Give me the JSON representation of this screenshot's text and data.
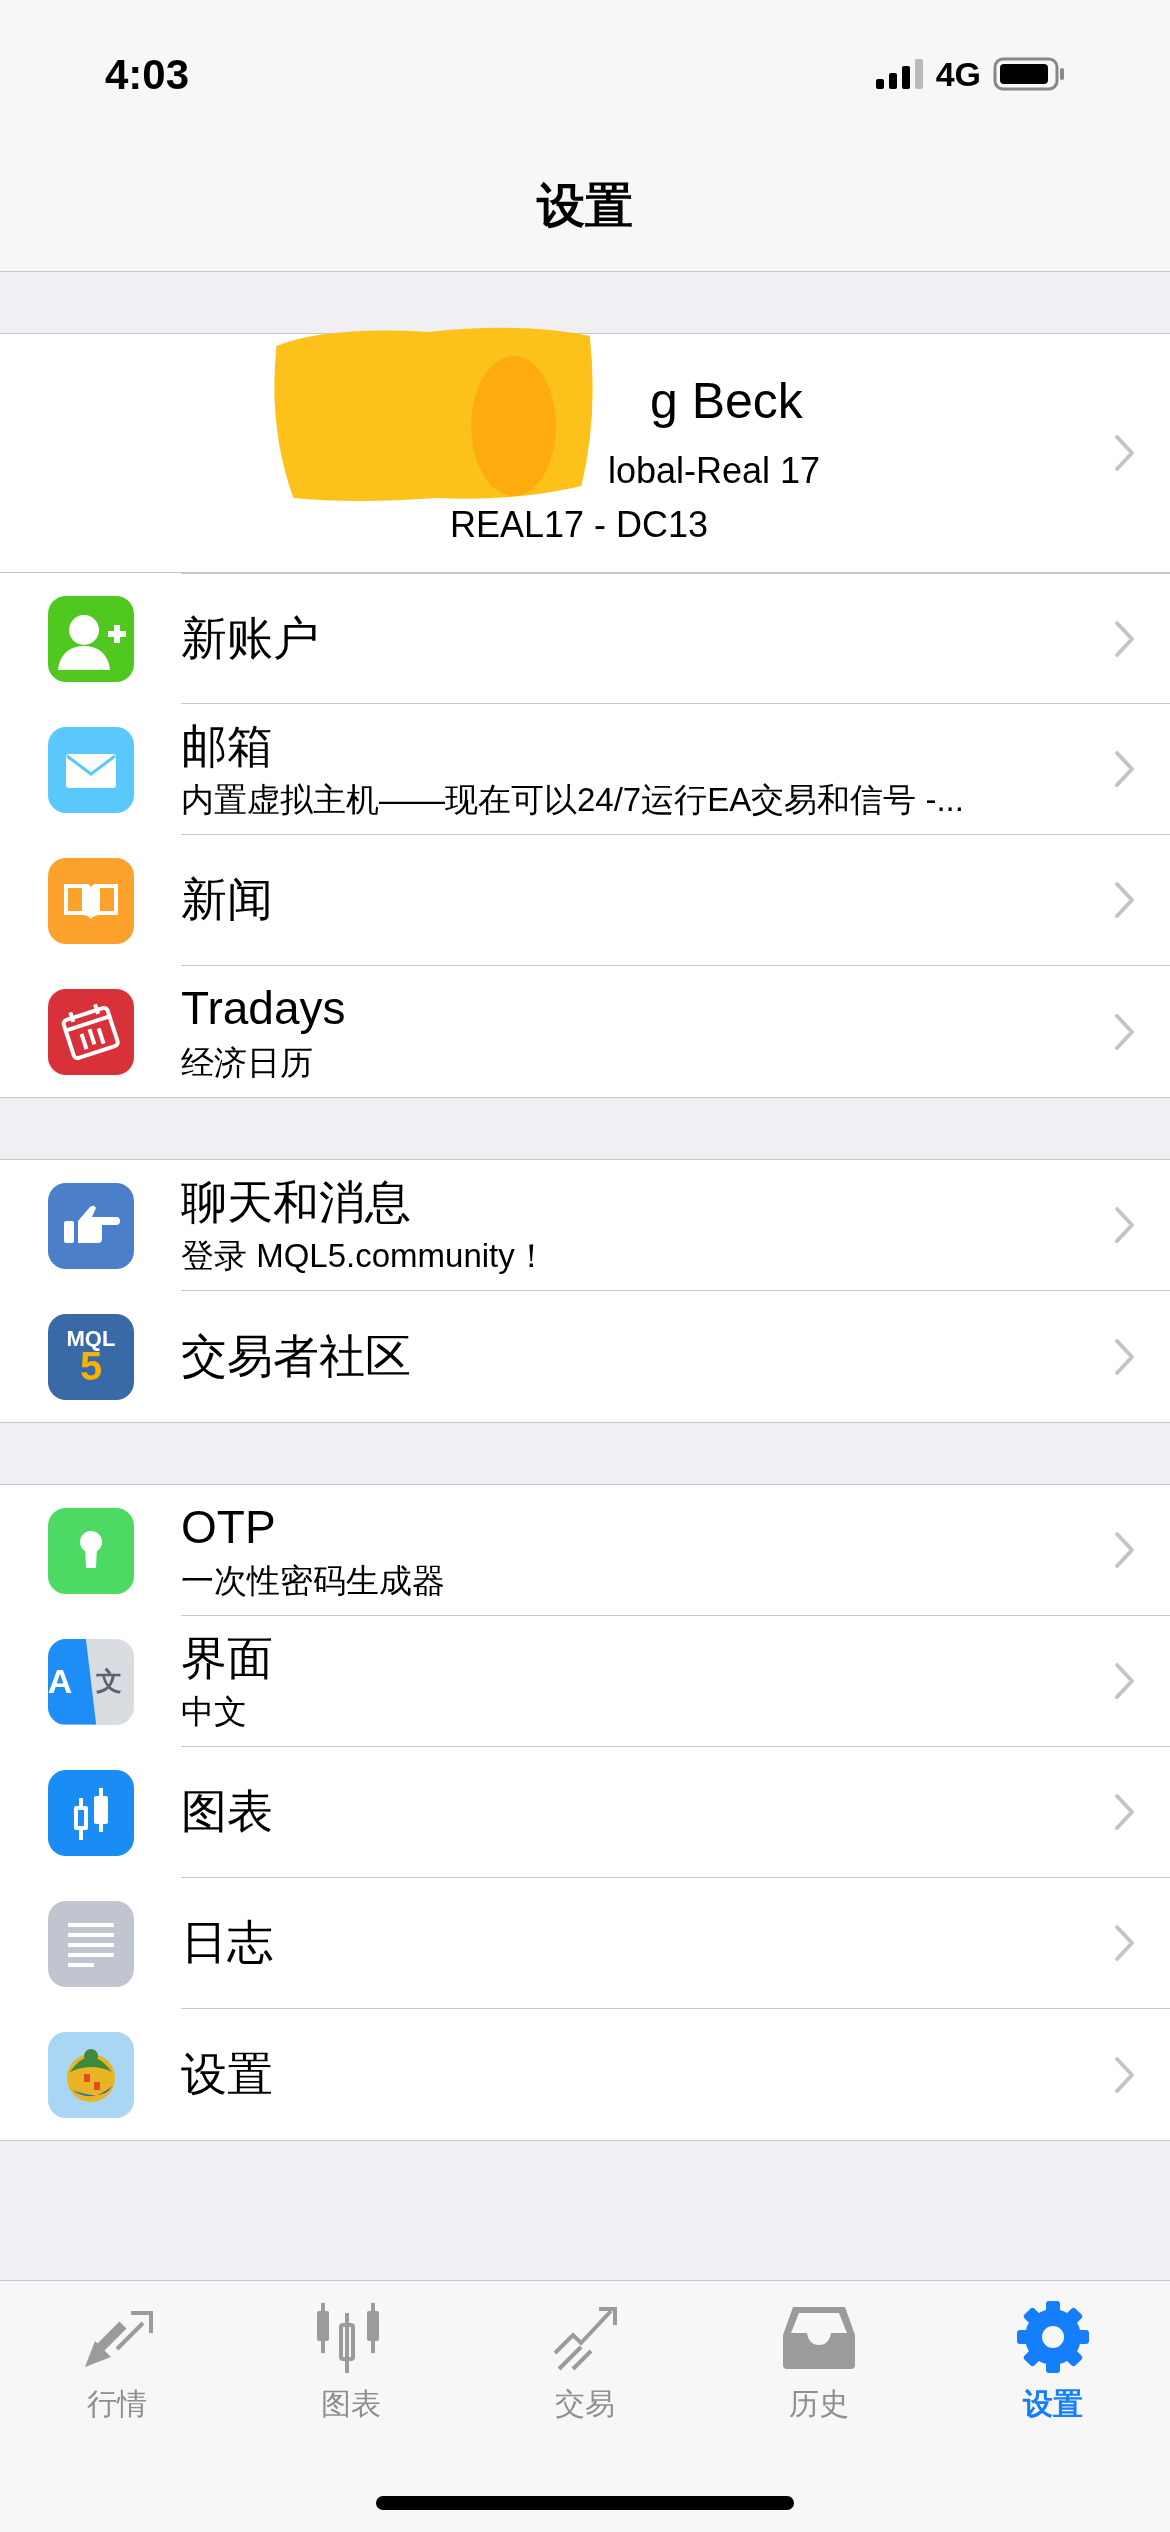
{
  "status_bar": {
    "time": "4:03",
    "network": "4G"
  },
  "header": {
    "title": "设置"
  },
  "account": {
    "name": "g Beck",
    "server": "lobal-Real 17",
    "cluster": "REAL17 - DC13"
  },
  "sections": [
    {
      "rows": [
        {
          "title": "新账户"
        },
        {
          "title": "邮箱",
          "subtitle": "内置虚拟主机——现在可以24/7运行EA交易和信号 -..."
        },
        {
          "title": "新闻"
        },
        {
          "title": "Tradays",
          "subtitle": "经济日历"
        }
      ]
    },
    {
      "rows": [
        {
          "title": "聊天和消息",
          "subtitle": "登录 MQL5.community！"
        },
        {
          "title": "交易者社区",
          "icon_text": [
            "MQL",
            "5"
          ]
        }
      ]
    },
    {
      "rows": [
        {
          "title": "OTP",
          "subtitle": "一次性密码生成器"
        },
        {
          "title": "界面",
          "subtitle": "中文",
          "icon_text": [
            "A",
            "文"
          ]
        },
        {
          "title": "图表"
        },
        {
          "title": "日志"
        },
        {
          "title": "设置"
        }
      ]
    }
  ],
  "tab_bar": [
    {
      "label": "行情",
      "selected": false
    },
    {
      "label": "图表",
      "selected": false
    },
    {
      "label": "交易",
      "selected": false
    },
    {
      "label": "历史",
      "selected": false
    },
    {
      "label": "设置",
      "selected": true
    }
  ]
}
